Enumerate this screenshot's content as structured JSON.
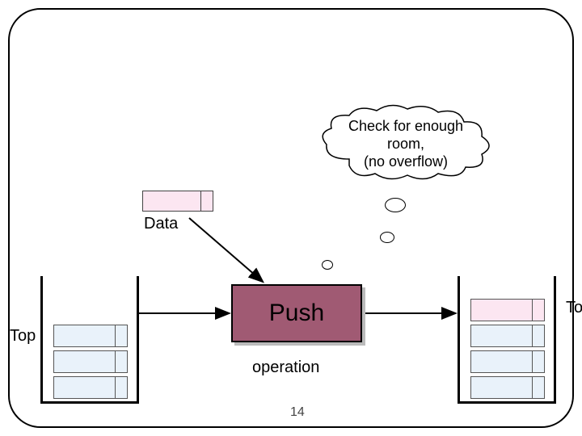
{
  "cloud_text_1": "Check for enough",
  "cloud_text_2": "room,",
  "cloud_text_3": "(no overflow)",
  "data_label": "Data",
  "top_left": "Top",
  "top_right": "Top",
  "push_label": "Push",
  "operation_label": "operation",
  "slide_number": "14",
  "colors": {
    "pink_cell": "#fce6f1",
    "blue_cell": "#e9f2fa",
    "push_block": "#a05a73"
  }
}
